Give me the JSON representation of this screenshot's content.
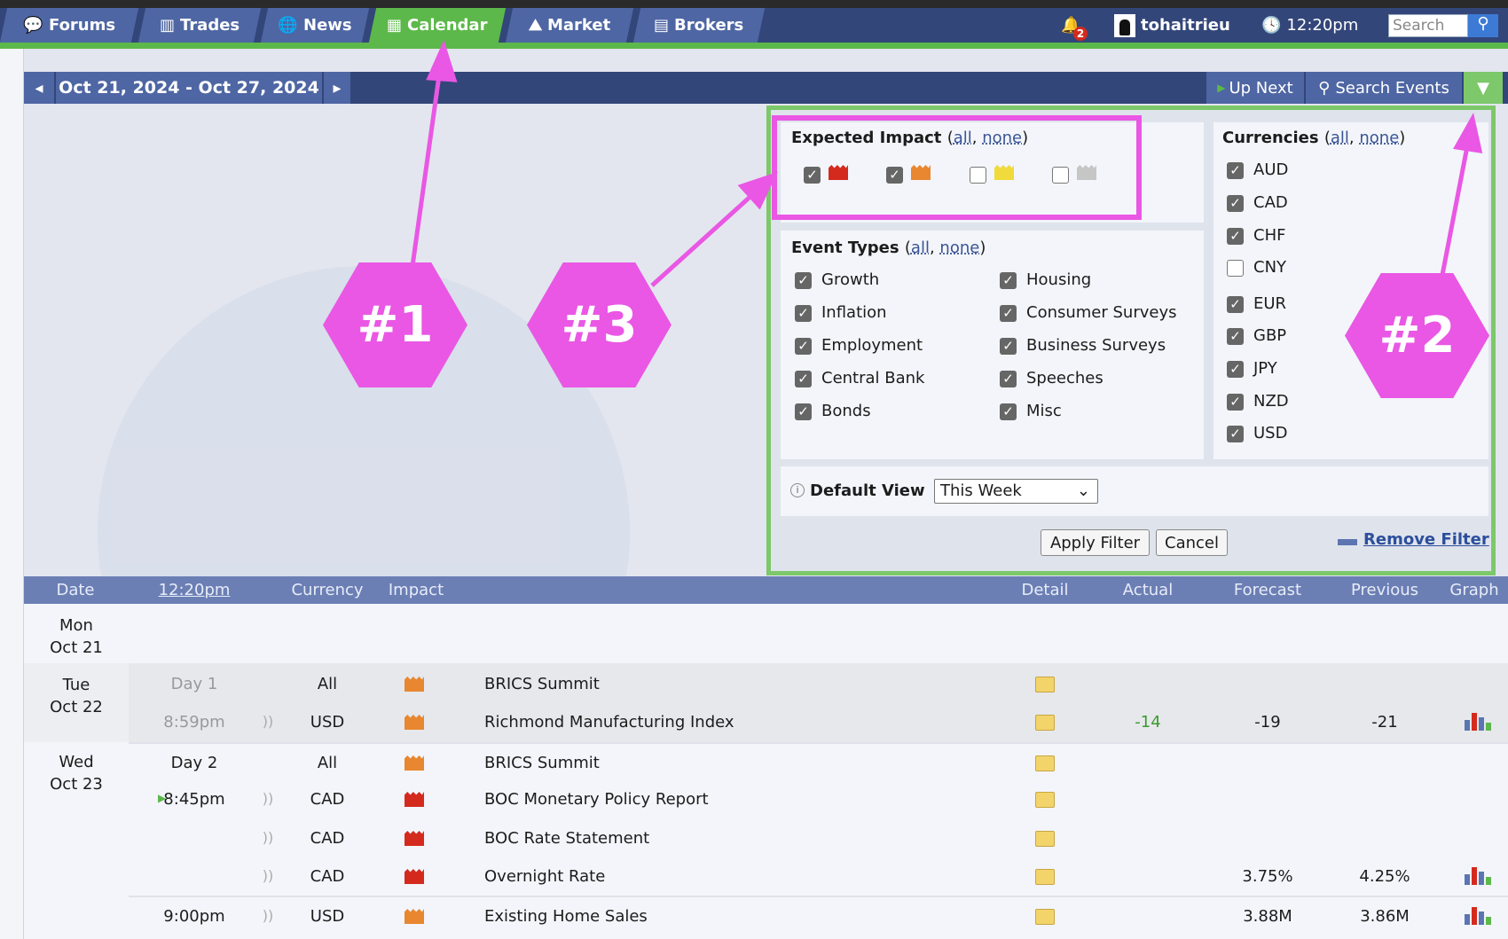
{
  "nav": {
    "tabs": [
      {
        "label": "Forums",
        "icon": "chat-bubbles-icon"
      },
      {
        "label": "Trades",
        "icon": "bar-chart-icon"
      },
      {
        "label": "News",
        "icon": "globe-icon"
      },
      {
        "label": "Calendar",
        "icon": "calendar-icon",
        "active": true
      },
      {
        "label": "Market",
        "icon": "market-chart-icon"
      },
      {
        "label": "Brokers",
        "icon": "building-icon"
      }
    ],
    "notifications": "2",
    "username": "tohaitrieu",
    "time": "12:20pm",
    "search_placeholder": "Search"
  },
  "datebar": {
    "range": "Oct 21, 2024 - Oct 27, 2024",
    "up_next": "Up Next",
    "search_events": "Search Events"
  },
  "filter": {
    "impact": {
      "title": "Expected Impact",
      "all": "all",
      "none": "none",
      "levels": [
        {
          "color": "#d42a1e",
          "checked": true
        },
        {
          "color": "#e8872f",
          "checked": true
        },
        {
          "color": "#f0da3c",
          "checked": false
        },
        {
          "color": "#c6c6c6",
          "checked": false
        }
      ]
    },
    "event_types": {
      "title": "Event Types",
      "all": "all",
      "none": "none",
      "items": [
        {
          "label": "Growth",
          "checked": true
        },
        {
          "label": "Inflation",
          "checked": true
        },
        {
          "label": "Employment",
          "checked": true
        },
        {
          "label": "Central Bank",
          "checked": true
        },
        {
          "label": "Bonds",
          "checked": true
        },
        {
          "label": "Housing",
          "checked": true
        },
        {
          "label": "Consumer Surveys",
          "checked": true
        },
        {
          "label": "Business Surveys",
          "checked": true
        },
        {
          "label": "Speeches",
          "checked": true
        },
        {
          "label": "Misc",
          "checked": true
        }
      ]
    },
    "currencies": {
      "title": "Currencies",
      "all": "all",
      "none": "none",
      "items": [
        {
          "label": "AUD",
          "checked": true
        },
        {
          "label": "CAD",
          "checked": true
        },
        {
          "label": "CHF",
          "checked": true
        },
        {
          "label": "CNY",
          "checked": false
        },
        {
          "label": "EUR",
          "checked": true
        },
        {
          "label": "GBP",
          "checked": true
        },
        {
          "label": "JPY",
          "checked": true
        },
        {
          "label": "NZD",
          "checked": true
        },
        {
          "label": "USD",
          "checked": true
        }
      ]
    },
    "default_view_label": "Default View",
    "default_view_value": "This Week",
    "apply": "Apply Filter",
    "cancel": "Cancel",
    "remove": "Remove Filter"
  },
  "table": {
    "headers": {
      "date": "Date",
      "time": "12:20pm",
      "currency": "Currency",
      "impact": "Impact",
      "detail": "Detail",
      "actual": "Actual",
      "forecast": "Forecast",
      "previous": "Previous",
      "graph": "Graph"
    },
    "days": [
      {
        "day": "Mon",
        "date": "Oct 21"
      },
      {
        "day": "Tue",
        "date": "Oct 22"
      },
      {
        "day": "Wed",
        "date": "Oct 23"
      }
    ],
    "rows": [
      {
        "time": "Day 1",
        "currency": "All",
        "impact": "#e8872f",
        "event": "BRICS Summit",
        "actual": "",
        "forecast": "",
        "previous": "",
        "graph": false
      },
      {
        "time": "8:59pm",
        "currency": "USD",
        "impact": "#e8872f",
        "event": "Richmond Manufacturing Index",
        "actual": "-14",
        "forecast": "-19",
        "previous": "-21",
        "graph": true
      },
      {
        "time": "Day 2",
        "currency": "All",
        "impact": "#e8872f",
        "event": "BRICS Summit",
        "actual": "",
        "forecast": "",
        "previous": "",
        "graph": false
      },
      {
        "time": "8:45pm",
        "currency": "CAD",
        "impact": "#d42a1e",
        "event": "BOC Monetary Policy Report",
        "actual": "",
        "forecast": "",
        "previous": "",
        "graph": false
      },
      {
        "time": "",
        "currency": "CAD",
        "impact": "#d42a1e",
        "event": "BOC Rate Statement",
        "actual": "",
        "forecast": "",
        "previous": "",
        "graph": false
      },
      {
        "time": "",
        "currency": "CAD",
        "impact": "#d42a1e",
        "event": "Overnight Rate",
        "actual": "",
        "forecast": "3.75%",
        "previous": "4.25%",
        "graph": true
      },
      {
        "time": "9:00pm",
        "currency": "USD",
        "impact": "#e8872f",
        "event": "Existing Home Sales",
        "actual": "",
        "forecast": "3.88M",
        "previous": "3.86M",
        "graph": true
      }
    ]
  },
  "annotations": [
    "#1",
    "#2",
    "#3"
  ],
  "colors": {
    "nav": "#33467a",
    "accent": "#5cb84a",
    "annotation": "#e957e4",
    "actual_better": "#3d9a2f"
  }
}
